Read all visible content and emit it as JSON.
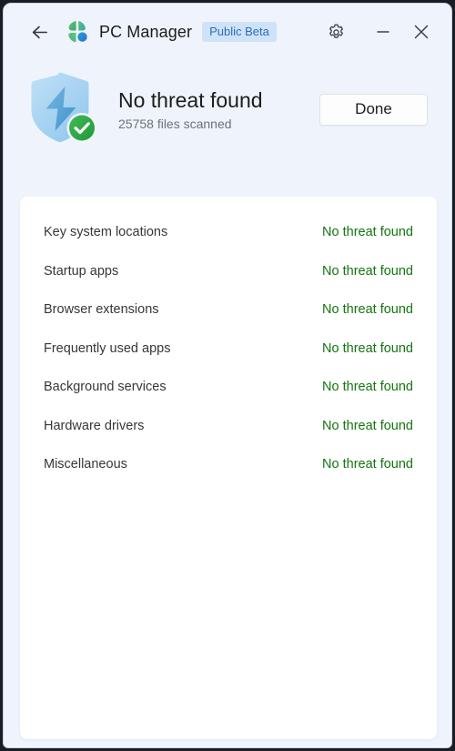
{
  "window": {
    "background_color": "#eff4fc",
    "card_color": "#ffffff"
  },
  "titlebar": {
    "back_label": "Back",
    "back_icon": "arrow-left-icon",
    "logo_icon": "pc-manager-logo-icon",
    "title": "PC Manager",
    "badge": "Public Beta",
    "badge_bg": "#cfe2f7",
    "badge_fg": "#2a6fbb",
    "settings_icon": "gear-icon",
    "minimize_icon": "minimize-icon",
    "close_icon": "close-icon"
  },
  "summary": {
    "shield_icon": "shield-with-lightning-bolt-icon",
    "check_icon": "check-circle-icon",
    "status_title": "No threat found",
    "status_subtitle": "25758 files scanned",
    "files_scanned": 25758,
    "done_label": "Done",
    "status_color": "#13760f",
    "shield_color": "#a9d4f2",
    "bolt_color": "#4a9fdc",
    "check_color": "#2eaa44"
  },
  "results": {
    "rows": [
      {
        "label": "Key system locations",
        "status": "No threat found"
      },
      {
        "label": "Startup apps",
        "status": "No threat found"
      },
      {
        "label": "Browser extensions",
        "status": "No threat found"
      },
      {
        "label": "Frequently used apps",
        "status": "No threat found"
      },
      {
        "label": "Background services",
        "status": "No threat found"
      },
      {
        "label": "Hardware drivers",
        "status": "No threat found"
      },
      {
        "label": "Miscellaneous",
        "status": "No threat found"
      }
    ]
  }
}
